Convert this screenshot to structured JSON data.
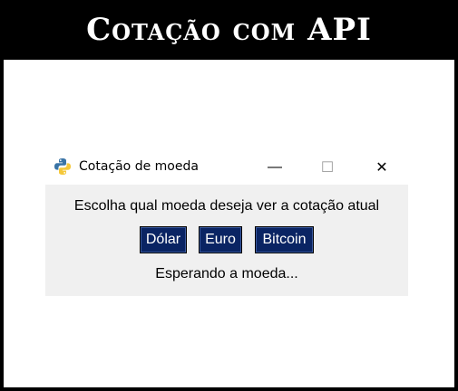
{
  "banner": {
    "title": "Cotação com API"
  },
  "window": {
    "title": "Cotação de moeda",
    "controls": {
      "minimize": "—",
      "maximize": "☐",
      "close": "✕"
    },
    "icon": "python-icon"
  },
  "content": {
    "prompt": "Escolha qual moeda deseja ver a cotação atual",
    "buttons": {
      "dolar": "Dólar",
      "euro": "Euro",
      "bitcoin": "Bitcoin"
    },
    "status": "Esperando a moeda..."
  },
  "colors": {
    "banner_bg": "#000000",
    "button_bg": "#0a2463",
    "client_bg": "#f0f0f0"
  }
}
